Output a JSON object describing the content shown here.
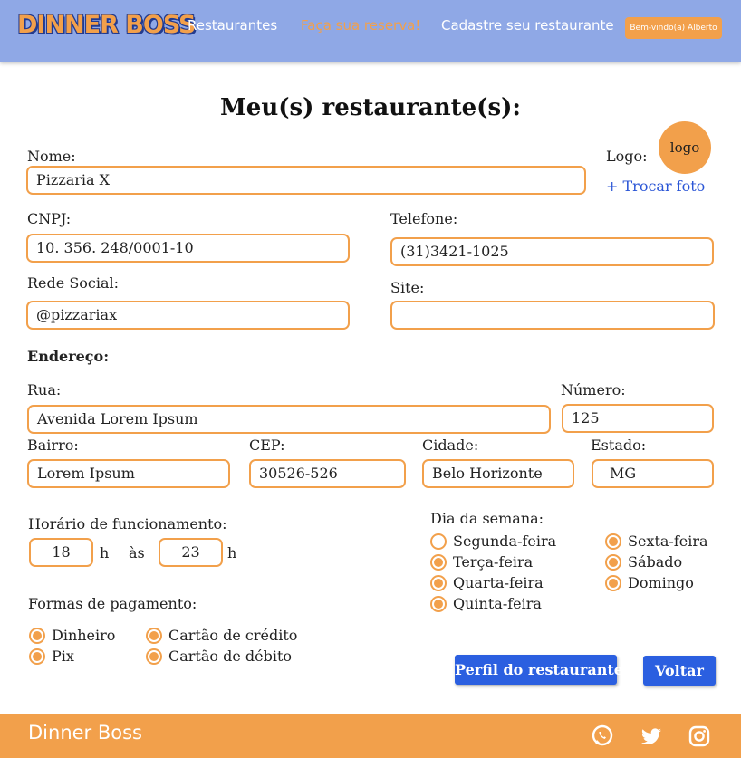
{
  "header": {
    "brand": "DINNER BOSS",
    "nav": [
      "Restaurantes",
      "Faça sua reserva!",
      "Cadastre seu restaurante"
    ],
    "welcome": "Bem-vindo(a) Alberto"
  },
  "page": {
    "title": "Meu(s) restaurante(s):"
  },
  "form": {
    "name_label": "Nome:",
    "name_value": "Pizzaria X",
    "logo_label": "Logo:",
    "logo_text": "logo",
    "change_photo": "+ Trocar foto",
    "cnpj_label": "CNPJ:",
    "cnpj_value": "10. 356. 248/0001-10",
    "phone_label": "Telefone:",
    "phone_value": "(31)3421-1025",
    "social_label": "Rede Social:",
    "social_value": "@pizzariax",
    "site_label": "Site:",
    "site_value": ""
  },
  "address": {
    "heading": "Endereço:",
    "street_label": "Rua:",
    "street_value": "Avenida Lorem Ipsum",
    "number_label": "Número:",
    "number_value": "125",
    "district_label": "Bairro:",
    "district_value": "Lorem Ipsum",
    "cep_label": "CEP:",
    "cep_value": "30526-526",
    "city_label": "Cidade:",
    "city_value": "Belo Horizonte",
    "state_label": "Estado:",
    "state_value": "MG"
  },
  "hours": {
    "label": "Horário de funcionamento:",
    "open": "18",
    "h1": "h",
    "between": "às",
    "close": "23",
    "h2": "h"
  },
  "weekdays": {
    "label": "Dia da semana:",
    "days": [
      {
        "name": "Segunda-feira",
        "checked": false
      },
      {
        "name": "Terça-feira",
        "checked": true
      },
      {
        "name": "Quarta-feira",
        "checked": true
      },
      {
        "name": "Quinta-feira",
        "checked": true
      },
      {
        "name": "Sexta-feira",
        "checked": true
      },
      {
        "name": "Sábado",
        "checked": true
      },
      {
        "name": "Domingo",
        "checked": true
      }
    ]
  },
  "payment": {
    "label": "Formas de pagamento:",
    "methods": [
      {
        "name": "Dinheiro",
        "checked": true
      },
      {
        "name": "Pix",
        "checked": true
      },
      {
        "name": "Cartão de crédito",
        "checked": true
      },
      {
        "name": "Cartão de débito",
        "checked": true
      }
    ]
  },
  "buttons": {
    "profile": "Perfil do restaurante",
    "back": "Voltar"
  },
  "footer": {
    "brand": "Dinner Boss",
    "icons": [
      "whatsapp-icon",
      "twitter-icon",
      "instagram-icon"
    ]
  },
  "colors": {
    "header": "#8fa8e6",
    "accent": "#f2a04b",
    "button": "#2b5fe0",
    "link": "#2b56d6"
  }
}
